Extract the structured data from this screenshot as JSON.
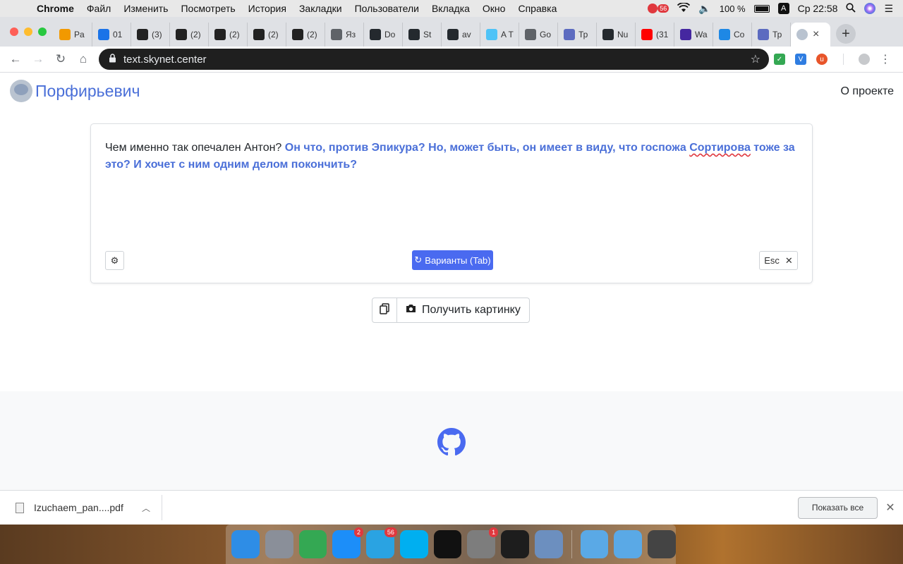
{
  "menubar": {
    "app": "Chrome",
    "items": [
      "Файл",
      "Изменить",
      "Посмотреть",
      "История",
      "Закладки",
      "Пользователи",
      "Вкладка",
      "Окно",
      "Справка"
    ],
    "notif_badge": "56",
    "battery": "100 %",
    "input_lang": "A",
    "clock": "Ср 22:58"
  },
  "tabs": [
    {
      "label": "Pa",
      "color": "#f29900",
      "icon": "tab-favicon-orange"
    },
    {
      "label": "01",
      "color": "#1a73e8",
      "icon": "tab-favicon-cloud"
    },
    {
      "label": "(3)",
      "color": "#222222",
      "icon": "tab-favicon-sh"
    },
    {
      "label": "(2)",
      "color": "#222222",
      "icon": "tab-favicon-sh"
    },
    {
      "label": "(2)",
      "color": "#222222",
      "icon": "tab-favicon-sh"
    },
    {
      "label": "(2)",
      "color": "#222222",
      "icon": "tab-favicon-sh"
    },
    {
      "label": "(2)",
      "color": "#222222",
      "icon": "tab-favicon-sh"
    },
    {
      "label": "Яз",
      "color": "#5f6368",
      "icon": "tab-favicon-m"
    },
    {
      "label": "Do",
      "color": "#24292e",
      "icon": "github-icon"
    },
    {
      "label": "St",
      "color": "#24292e",
      "icon": "github-icon"
    },
    {
      "label": "av",
      "color": "#24292e",
      "icon": "github-icon"
    },
    {
      "label": "A T",
      "color": "#4fc3f7",
      "icon": "tab-favicon-doc"
    },
    {
      "label": "Go",
      "color": "#5f6368",
      "icon": "tab-favicon-grid"
    },
    {
      "label": "Тр",
      "color": "#5c6bc0",
      "icon": "tab-favicon-star"
    },
    {
      "label": "Nu",
      "color": "#24292e",
      "icon": "github-icon"
    },
    {
      "label": "(31",
      "color": "#ff0000",
      "icon": "youtube-icon"
    },
    {
      "label": "Wa",
      "color": "#4527a0",
      "icon": "tab-favicon-diamond"
    },
    {
      "label": "Co",
      "color": "#1e88e5",
      "icon": "tab-favicon-chat"
    },
    {
      "label": "Тр",
      "color": "#5c6bc0",
      "icon": "tab-favicon-star"
    }
  ],
  "active_tab": {
    "color": "#b9c3d0"
  },
  "address": {
    "url": "text.skynet.center"
  },
  "site": {
    "brand": "Порфирьевич",
    "about_link": "О проекте",
    "prompt_text": "Чем именно так опечален Антон? ",
    "generated_pre": "Он что, против Эпикура? Но, может быть, он имеет в виду, что госпожа ",
    "generated_misspelled": "Сортирова",
    "generated_post": " тоже за это? И хочет с ним одним делом покончить?",
    "variants_button": "Варианты (Tab)",
    "esc_button": "Esc",
    "get_picture_button": "Получить картинку",
    "accent_color": "#4a6fd8"
  },
  "downloads": {
    "file_name": "Izuchaem_pan....pdf",
    "show_all": "Показать все"
  },
  "dock": [
    {
      "name": "finder-icon",
      "color": "#2e8de6",
      "badge": ""
    },
    {
      "name": "launchpad-icon",
      "color": "#8a8f99",
      "badge": ""
    },
    {
      "name": "chrome-icon",
      "color": "#34a853",
      "badge": ""
    },
    {
      "name": "app-store-icon",
      "color": "#1c8ef9",
      "badge": "2"
    },
    {
      "name": "telegram-icon",
      "color": "#2aa3e2",
      "badge": "56"
    },
    {
      "name": "skype-icon",
      "color": "#00aff0",
      "badge": ""
    },
    {
      "name": "terminal-icon",
      "color": "#111111",
      "badge": ""
    },
    {
      "name": "system-preferences-icon",
      "color": "#7d7d7d",
      "badge": "1"
    },
    {
      "name": "terminal-green-icon",
      "color": "#1d1d1d",
      "badge": ""
    },
    {
      "name": "preview-icon",
      "color": "#6c8fbf",
      "badge": ""
    },
    {
      "name": "downloads-folder-icon",
      "color": "#5aa9e6",
      "badge": ""
    },
    {
      "name": "applications-folder-icon",
      "color": "#5aa9e6",
      "badge": ""
    },
    {
      "name": "trash-icon",
      "color": "#444444",
      "badge": ""
    }
  ]
}
